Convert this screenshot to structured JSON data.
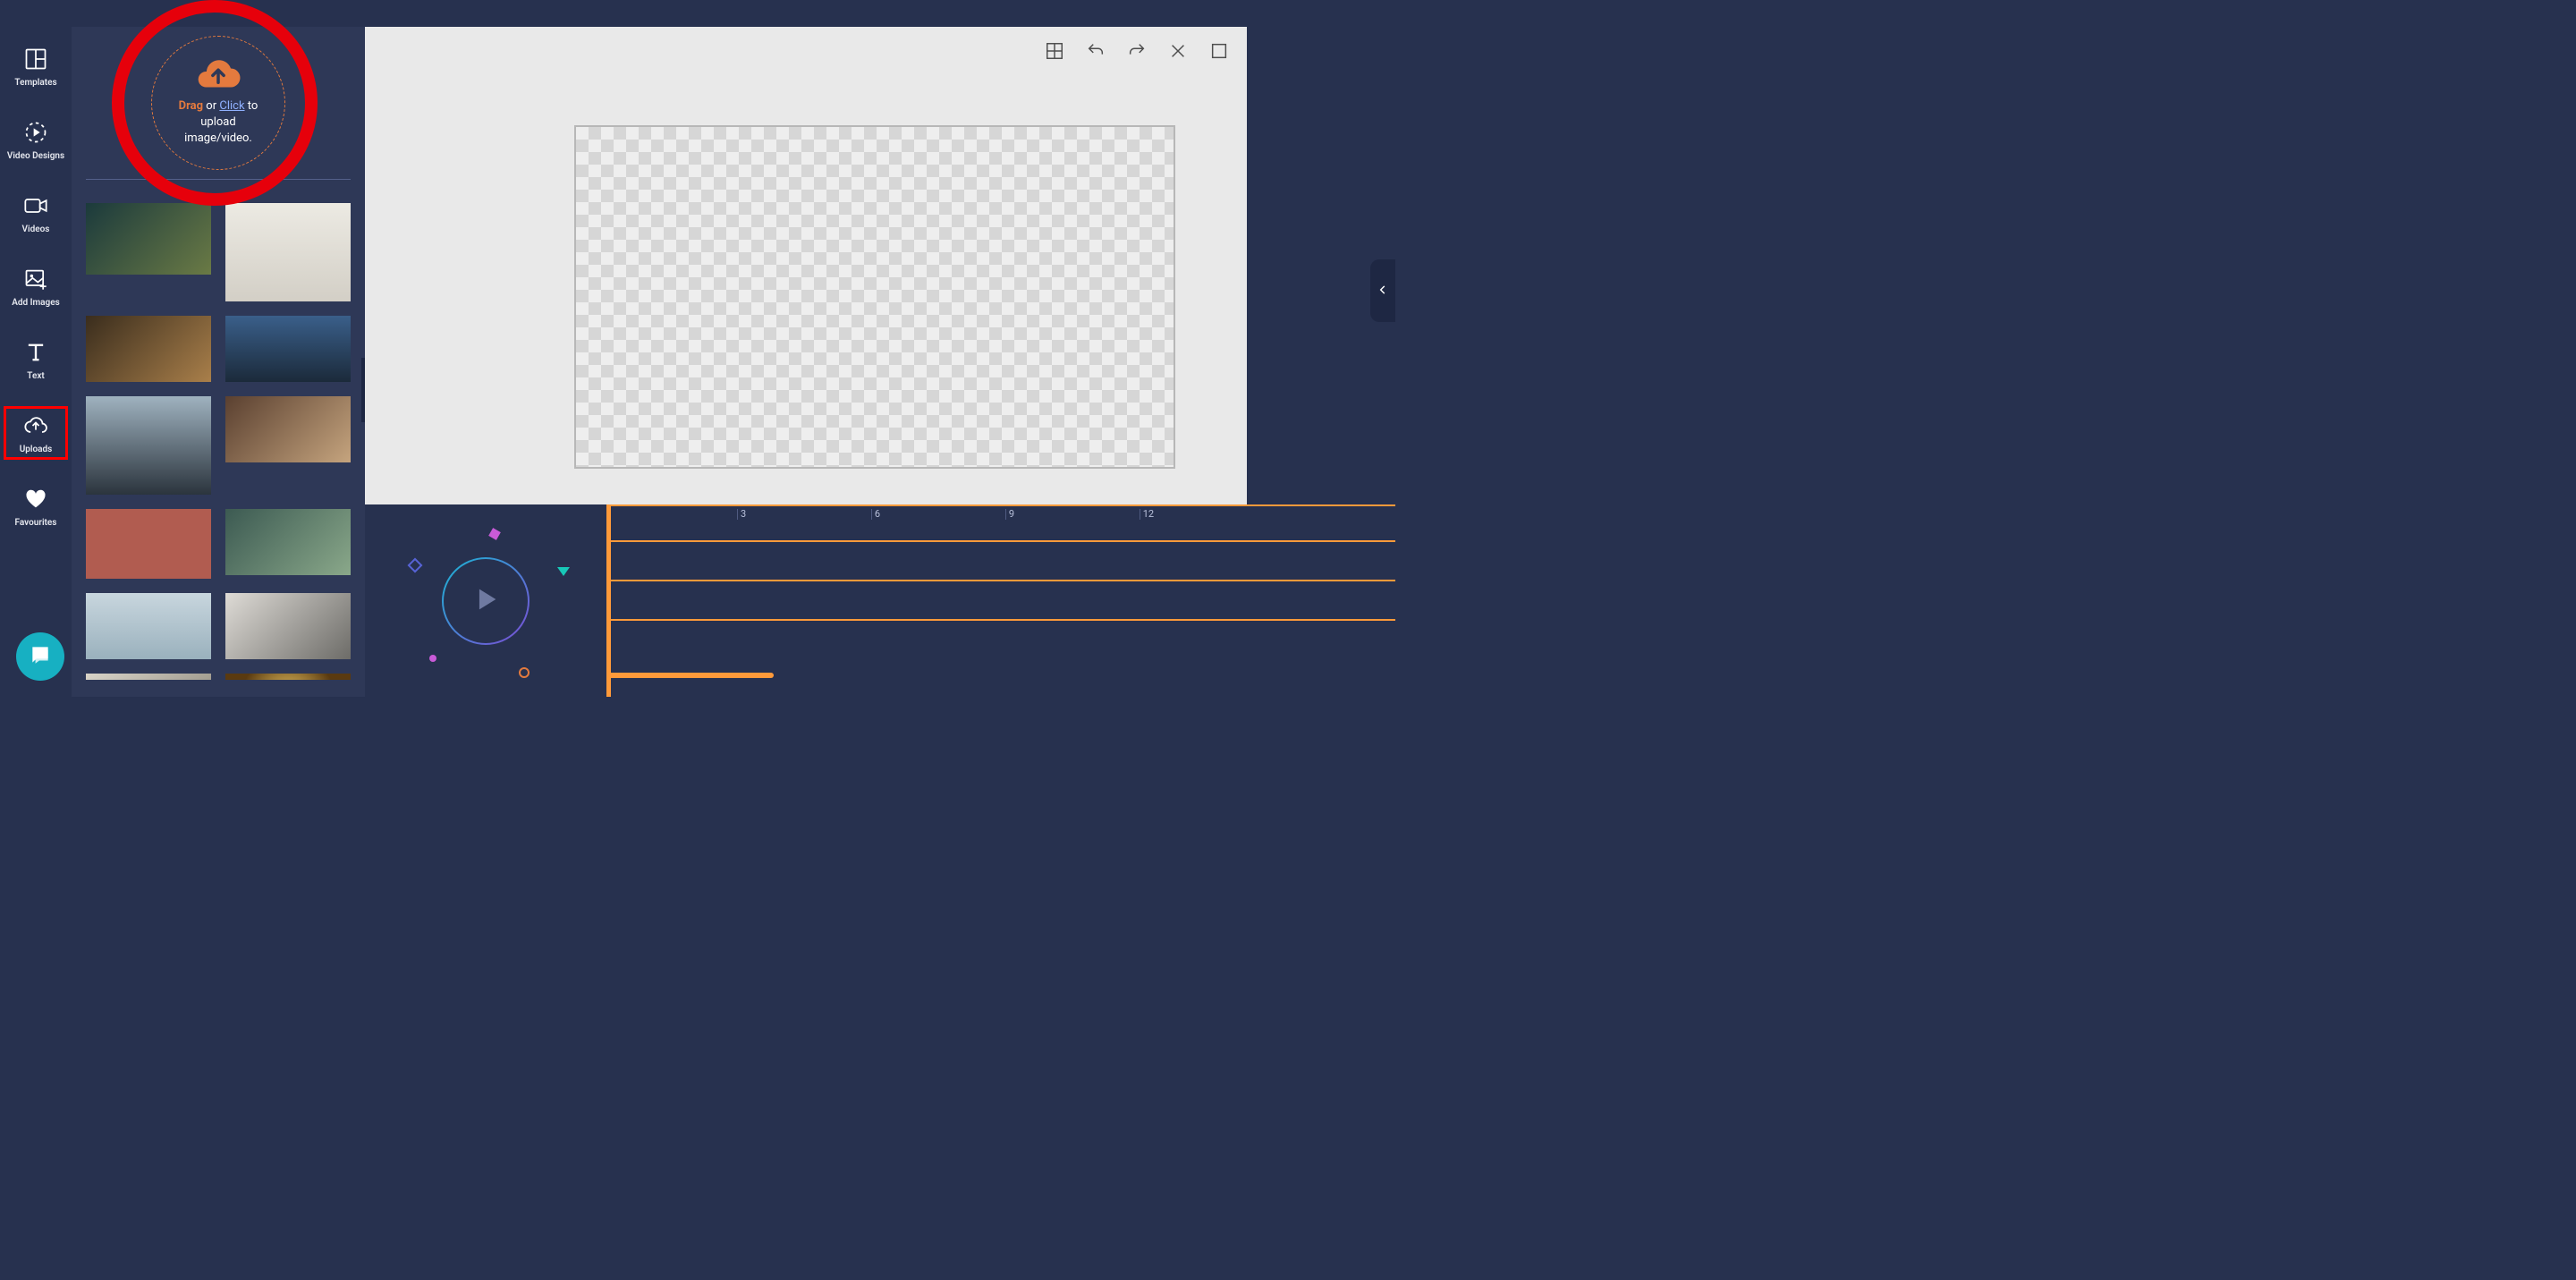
{
  "nav": {
    "items": [
      {
        "id": "templates",
        "label": "Templates",
        "icon": "templates-icon"
      },
      {
        "id": "video-designs",
        "label": "Video Designs",
        "icon": "video-designs-icon"
      },
      {
        "id": "videos",
        "label": "Videos",
        "icon": "videos-icon"
      },
      {
        "id": "add-images",
        "label": "Add Images",
        "icon": "add-images-icon"
      },
      {
        "id": "text",
        "label": "Text",
        "icon": "text-icon"
      },
      {
        "id": "uploads",
        "label": "Uploads",
        "icon": "uploads-icon",
        "selected": true
      },
      {
        "id": "favourites",
        "label": "Favourites",
        "icon": "favourites-icon"
      }
    ]
  },
  "upload_drop": {
    "drag_word": "Drag",
    "or_word": "or",
    "click_word": "Click",
    "to_word": "to",
    "line2": "upload",
    "line3": "image/video."
  },
  "thumbnails": [
    {
      "name": "breakfast-flatlay",
      "h": 80,
      "bg": "linear-gradient(135deg,#1b3a3c,#6a7a45)"
    },
    {
      "name": "wreath-window",
      "h": 110,
      "bg": "linear-gradient(180deg,#eceae3,#d3cfc6)"
    },
    {
      "name": "cooking-hands",
      "h": 74,
      "bg": "linear-gradient(135deg,#3a2d1d,#a97f4a)"
    },
    {
      "name": "backpack-city",
      "h": 74,
      "bg": "linear-gradient(180deg,#3a5f8a,#1b2a3a)"
    },
    {
      "name": "skyscraper",
      "h": 110,
      "bg": "linear-gradient(180deg,#9fb2bf,#2b343d)"
    },
    {
      "name": "couple-hug",
      "h": 74,
      "bg": "linear-gradient(135deg,#5a4030,#c5a47e)"
    },
    {
      "name": "rose-flower",
      "h": 78,
      "bg": "#b15c50"
    },
    {
      "name": "couple-selfie",
      "h": 74,
      "bg": "linear-gradient(135deg,#3c5a52,#8aa88a)"
    },
    {
      "name": "balloons-sky",
      "h": 74,
      "bg": "linear-gradient(180deg,#c8d6de,#9ab1bd)"
    },
    {
      "name": "handshake",
      "h": 74,
      "bg": "linear-gradient(135deg,#dedbd6,#6d6c68)"
    },
    {
      "name": "sofa-laptop",
      "h": 74,
      "bg": "linear-gradient(135deg,#d9d4c8,#8a8578)"
    },
    {
      "name": "sparkler",
      "h": 62,
      "bg": "radial-gradient(circle,#f7d26a 0%,#5a3a10 70%)"
    }
  ],
  "canvas_toolbar": {
    "grid": "Grid",
    "undo": "Undo",
    "redo": "Redo",
    "close": "Close",
    "stop": "Stop"
  },
  "timeline": {
    "ticks": [
      {
        "t": "3",
        "pct": 17
      },
      {
        "t": "6",
        "pct": 34
      },
      {
        "t": "9",
        "pct": 51
      },
      {
        "t": "12",
        "pct": 68
      }
    ]
  }
}
